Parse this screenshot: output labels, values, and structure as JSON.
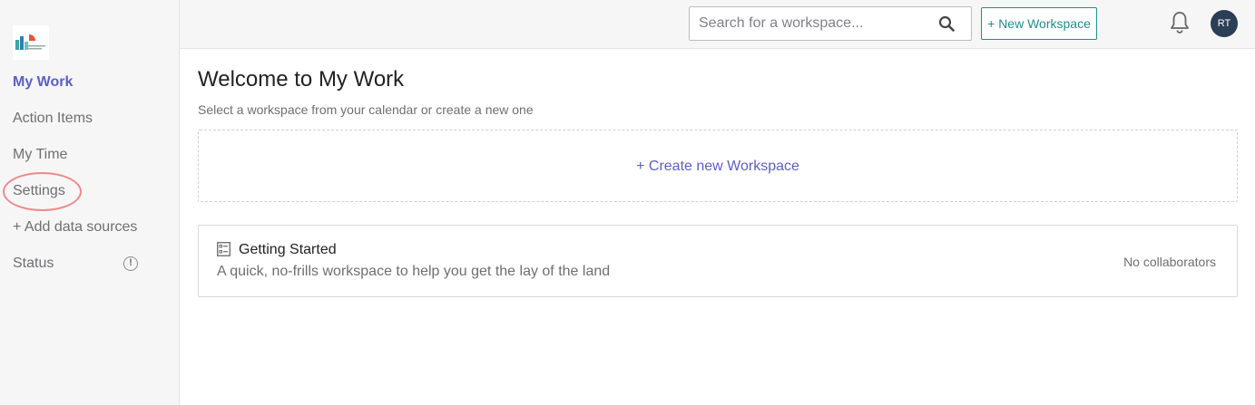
{
  "sidebar": {
    "items": [
      {
        "label": "My Work",
        "active": true
      },
      {
        "label": "Action Items"
      },
      {
        "label": "My Time"
      },
      {
        "label": "Settings"
      },
      {
        "label": "+ Add data sources"
      },
      {
        "label": "Status"
      }
    ],
    "status_icon_glyph": "!"
  },
  "header": {
    "search_placeholder": "Search for a workspace...",
    "new_workspace_label": "+ New Workspace",
    "avatar_initials": "RT"
  },
  "main": {
    "title": "Welcome to My Work",
    "subtitle": "Select a workspace from your calendar or create a new one",
    "create_label": "+ Create new Workspace",
    "workspaces": [
      {
        "title": "Getting Started",
        "description": "A quick, no-frills workspace to help you get the lay of the land",
        "collaborators": "No collaborators"
      }
    ]
  },
  "colors": {
    "accent": "#5b5fc7",
    "teal": "#1f8f8a",
    "highlight": "#ef8a8a",
    "avatar_bg": "#2c3e55"
  }
}
